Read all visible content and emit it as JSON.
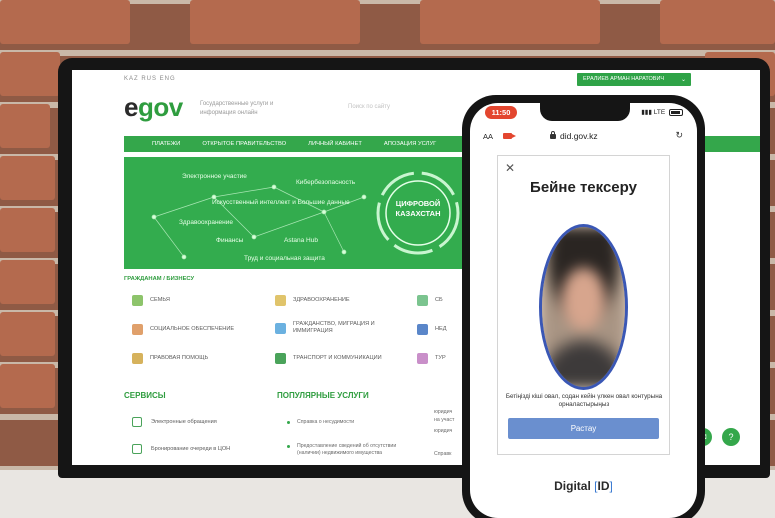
{
  "egov": {
    "languages": "KAZ  RUS  ENG",
    "user_button": "ЕРАЛИЕВ АРМАН НАРАТОВИЧ",
    "logo_e": "e",
    "logo_rest": "gov",
    "tagline": "Государственные услуги и информация онлайн",
    "search_hint": "Поиск по сайту",
    "menu": [
      "ПЛАТЕЖИ",
      "ОТКРЫТОЕ ПРАВИТЕЛЬСТВО",
      "ЛИЧНЫЙ КАБИНЕТ",
      "АПОЗАЦИЯ УСЛУГ"
    ],
    "banner": {
      "labels": [
        "Электронное участие",
        "Кибербезопасность",
        "Искусственный интеллект и Большие данные",
        "Здравоохранение",
        "Финансы",
        "Astana Hub",
        "Труд и социальная защита"
      ],
      "ring_text": "ЦИФРОВОЙ КАЗАХСТАН"
    },
    "section_label": "ГРАЖДАНАМ / БИЗНЕСУ",
    "categories": [
      "СЕМЬЯ",
      "ЗДРАВООХРАНЕНИЕ",
      "СБ",
      "СОЦИАЛЬНОЕ ОБЕСПЕЧЕНИЕ",
      "ГРАЖДАНСТВО, МИГРАЦИЯ И ИММИГРАЦИЯ",
      "НЕД",
      "ПРАВОВАЯ ПОМОЩЬ",
      "ТРАНСПОРТ И КОММУНИКАЦИИ",
      "ТУР"
    ],
    "services_title": "СЕРВИСЫ",
    "services": [
      "Электронные обращения",
      "Бронирование очереди в ЦОН"
    ],
    "popular_title": "ПОПУЛЯРНЫЕ УСЛУГИ",
    "popular": [
      "Справка о несудимости",
      "Предоставление сведений об отсутствии (наличии) недвижимого имущества"
    ],
    "popular_right": [
      "юридич",
      "на участ",
      "юридич",
      "Справк"
    ]
  },
  "phone": {
    "time": "11:50",
    "network": "LTE",
    "aa": "AA",
    "url": "did.gov.kz",
    "modal_title": "Бейне тексеру",
    "hint": "Бетіңізді кіші овал, содан кейін үлкен овал контурына орналастырыңыз",
    "button": "Растау",
    "brand_text": "Digital",
    "brand_open": "[",
    "brand_id": "ID",
    "brand_close": "]"
  },
  "colors": {
    "egov_green": "#34a74b",
    "accent_blue": "#3a57b5",
    "button_blue": "#6a8fcf"
  }
}
